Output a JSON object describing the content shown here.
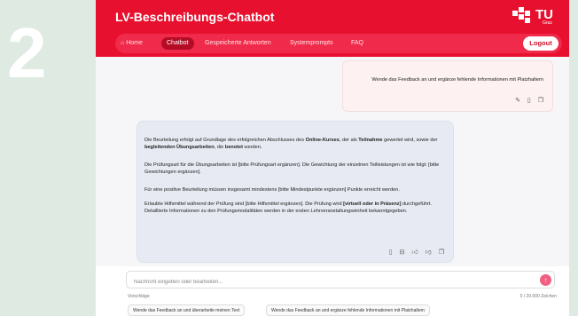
{
  "step_number": "2",
  "app": {
    "title": "LV-Beschreibungs-Chatbot",
    "logo_text": "TU",
    "logo_sub": "Graz"
  },
  "nav": {
    "home": "Home",
    "chatbot": "Chatbot",
    "saved": "Gespeicherte Antworten",
    "prompts": "Systemprompts",
    "faq": "FAQ",
    "logout": "Logout"
  },
  "user_message": {
    "text": "Wende das Feedback an und ergänze fehlende Informationen mit Platzhaltern"
  },
  "bot_message": {
    "p1_a": "Die Beurteilung erfolgt auf Grundlage des erfolgreichen Abschlusses des ",
    "p1_b": "Online-Kurses",
    "p1_c": ", der als ",
    "p1_d": "Teilnahme",
    "p1_e": " gewertet wird, sowie der ",
    "p1_f": "begleitenden Übungsarbeiten",
    "p1_g": ", die ",
    "p1_h": "benotet",
    "p1_i": " werden.",
    "p2": "Die Prüfungsart für die Übungsarbeiten ist [bitte Prüfungsart ergänzen]. Die Gewichtung der einzelnen Teilleistungen ist wie folgt: [bitte Gewichtungen ergänzen].",
    "p3": "Für eine positive Beurteilung müssen insgesamt mindestens [bitte Mindestpunkte ergänzen] Punkte erreicht werden.",
    "p4_a": "Erlaubte Hilfsmittel während der Prüfung sind [bitte Hilfsmittel ergänzen]. Die Prüfung wird ",
    "p4_b": "[virtuell oder in Präsenz]",
    "p4_c": " durchgeführt. Detaillierte Informationen zu den Prüfungsmodalitäten werden in der ersten Lehrveranstaltungseinheit bekanntgegeben."
  },
  "input": {
    "placeholder": "Nachricht eingeben oder bearbeiten...",
    "suggestions_label": "Vorschläge",
    "char_count": "0 / 20.000 Zeichen"
  },
  "suggestions": [
    "Wende das Feedback an und überarbeite meinen Text",
    "Wende das Feedback an und ergänze fehlende Informationen mit Platzhaltern"
  ],
  "colors": {
    "brand_red": "#e8102f",
    "nav_pill": "#f02a4a",
    "side_panel": "#dfeae3"
  }
}
